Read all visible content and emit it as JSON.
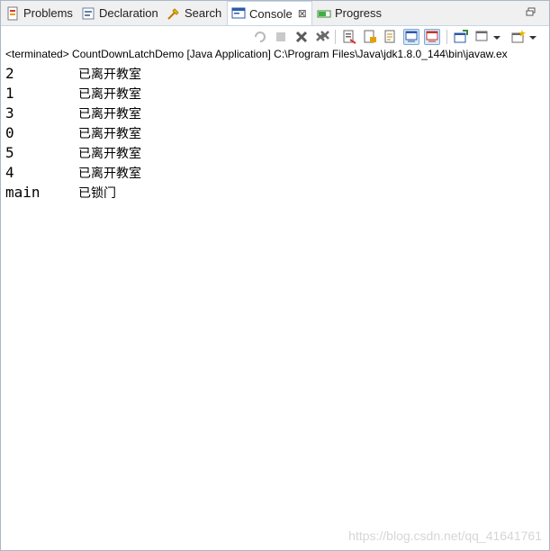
{
  "tabs": [
    {
      "label": "Problems",
      "icon": "problems-icon"
    },
    {
      "label": "Declaration",
      "icon": "declaration-icon"
    },
    {
      "label": "Search",
      "icon": "search-icon"
    },
    {
      "label": "Console",
      "icon": "console-icon",
      "active": true,
      "close": "⊠"
    },
    {
      "label": "Progress",
      "icon": "progress-icon"
    }
  ],
  "status": {
    "text": "<terminated> CountDownLatchDemo [Java Application] C:\\Program Files\\Java\\jdk1.8.0_144\\bin\\javaw.ex"
  },
  "console": {
    "lines": [
      {
        "name": "2",
        "message": "已离开教室"
      },
      {
        "name": "1",
        "message": "已离开教室"
      },
      {
        "name": "3",
        "message": "已离开教室"
      },
      {
        "name": "0",
        "message": "已离开教室"
      },
      {
        "name": "5",
        "message": "已离开教室"
      },
      {
        "name": "4",
        "message": "已离开教室"
      },
      {
        "name": "main",
        "message": "已锁门"
      }
    ]
  },
  "watermark": "https://blog.csdn.net/qq_41641761",
  "colors": {
    "accent": "#7aa7d8",
    "tab_border": "#c9d5e3"
  }
}
